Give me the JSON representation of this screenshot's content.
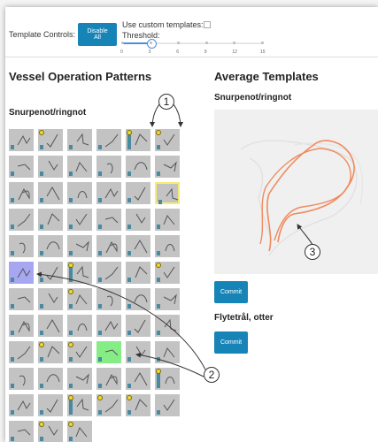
{
  "controls": {
    "label": "Template Controls:",
    "disable_button": "Disable All",
    "custom_templates_label": "Use custom templates:",
    "threshold_label": "Threshold:",
    "threshold_value": 3,
    "ticks": [
      "0",
      "3",
      "6",
      "9",
      "12",
      "15"
    ]
  },
  "left": {
    "title": "Vessel Operation Patterns",
    "section": "Snurpenot/ringnot"
  },
  "right": {
    "title": "Average Templates",
    "section1": "Snurpenot/ringnot",
    "commit_label": "Commit",
    "section2": "Flytetrål, otter",
    "commit2_label": "Commit"
  },
  "callouts": [
    "1",
    "2",
    "3"
  ],
  "cells": [
    {
      "bar": 0.25,
      "dot": false
    },
    {
      "bar": 0.25,
      "dot": true
    },
    {
      "bar": 0.25,
      "dot": false
    },
    {
      "bar": 0.25,
      "dot": false
    },
    {
      "bar": 1.0,
      "dot": true
    },
    {
      "bar": 0.25,
      "dot": true
    },
    {
      "bar": 0.25,
      "dot": false
    },
    {
      "bar": 0.25,
      "dot": false
    },
    {
      "bar": 0.25,
      "dot": false
    },
    {
      "bar": 0.25,
      "dot": false
    },
    {
      "bar": 0.25,
      "dot": false
    },
    {
      "bar": 0.25,
      "dot": false
    },
    {
      "bar": 0.25,
      "dot": false
    },
    {
      "bar": 0.25,
      "dot": false
    },
    {
      "bar": 0.25,
      "dot": false
    },
    {
      "bar": 0.25,
      "dot": false
    },
    {
      "bar": 0.25,
      "dot": false
    },
    {
      "bar": 0.25,
      "dot": false,
      "hl": "yellow"
    },
    {
      "bar": 0.25,
      "dot": false
    },
    {
      "bar": 0.25,
      "dot": false
    },
    {
      "bar": 0.25,
      "dot": false
    },
    {
      "bar": 0.25,
      "dot": false
    },
    {
      "bar": 0.25,
      "dot": false
    },
    {
      "bar": 0.25,
      "dot": false
    },
    {
      "bar": 0.25,
      "dot": false
    },
    {
      "bar": 0.25,
      "dot": false
    },
    {
      "bar": 0.25,
      "dot": false
    },
    {
      "bar": 0.25,
      "dot": false
    },
    {
      "bar": 0.25,
      "dot": false
    },
    {
      "bar": 0.25,
      "dot": false
    },
    {
      "bar": 0.25,
      "dot": false,
      "hl": "blue"
    },
    {
      "bar": 0.25,
      "dot": false
    },
    {
      "bar": 1.0,
      "dot": true
    },
    {
      "bar": 0.25,
      "dot": false
    },
    {
      "bar": 0.25,
      "dot": false
    },
    {
      "bar": 0.25,
      "dot": true
    },
    {
      "bar": 0.25,
      "dot": false
    },
    {
      "bar": 0.25,
      "dot": false
    },
    {
      "bar": 0.25,
      "dot": true
    },
    {
      "bar": 0.25,
      "dot": false
    },
    {
      "bar": 0.25,
      "dot": false
    },
    {
      "bar": 0.25,
      "dot": false
    },
    {
      "bar": 0.25,
      "dot": false
    },
    {
      "bar": 0.25,
      "dot": false
    },
    {
      "bar": 0.25,
      "dot": false
    },
    {
      "bar": 0.25,
      "dot": false
    },
    {
      "bar": 0.25,
      "dot": false
    },
    {
      "bar": 0.25,
      "dot": false
    },
    {
      "bar": 0.25,
      "dot": false
    },
    {
      "bar": 0.25,
      "dot": true
    },
    {
      "bar": 0.25,
      "dot": true
    },
    {
      "bar": 0.25,
      "dot": false,
      "hl": "green"
    },
    {
      "bar": 0.25,
      "dot": false
    },
    {
      "bar": 0.25,
      "dot": false
    },
    {
      "bar": 0.25,
      "dot": false
    },
    {
      "bar": 0.25,
      "dot": false
    },
    {
      "bar": 0.25,
      "dot": false
    },
    {
      "bar": 0.25,
      "dot": false
    },
    {
      "bar": 0.25,
      "dot": false
    },
    {
      "bar": 1.0,
      "dot": true
    },
    {
      "bar": 0.25,
      "dot": false
    },
    {
      "bar": 0.25,
      "dot": false
    },
    {
      "bar": 1.0,
      "dot": true
    },
    {
      "bar": 0.25,
      "dot": true
    },
    {
      "bar": 0.25,
      "dot": true
    },
    {
      "bar": 0.25,
      "dot": false
    },
    {
      "bar": 0.25,
      "dot": false
    },
    {
      "bar": 0.25,
      "dot": true
    },
    {
      "bar": 0.25,
      "dot": true
    }
  ],
  "colors": {
    "accent": "#1784b7",
    "highlight_yellow": "#f7ec6c",
    "highlight_blue": "#a7a7f1",
    "highlight_green": "#86ec86",
    "bar": "#4a8aa0",
    "curve": "#f08a5d"
  }
}
